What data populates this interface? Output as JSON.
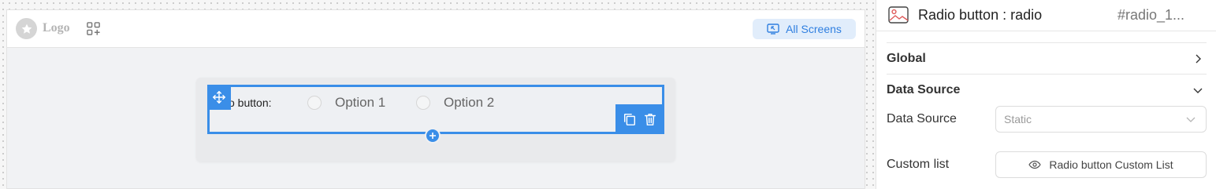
{
  "canvas": {
    "logo_text": "Logo",
    "all_screens_label": "All Screens",
    "widget": {
      "label": "o button:",
      "options": [
        {
          "label": "Option 1",
          "selected": false
        },
        {
          "label": "Option 2",
          "selected": false
        }
      ]
    }
  },
  "panel": {
    "title": "Radio button : radio",
    "component_id": "#radio_1...",
    "sections": {
      "global": "Global",
      "data_source": "Data Source"
    },
    "fields": {
      "data_source_label": "Data Source",
      "data_source_value": "Static",
      "custom_list_label": "Custom list",
      "custom_list_button": "Radio button Custom List"
    }
  },
  "colors": {
    "accent": "#3a8ee8",
    "all_screens_bg": "#e1edfb",
    "all_screens_text": "#2f7fe0"
  },
  "icons": [
    "star-icon",
    "add-widget-icon",
    "screens-icon",
    "move-icon",
    "duplicate-icon",
    "trash-icon",
    "plus-icon",
    "image-icon",
    "chevron-right-icon",
    "chevron-down-icon",
    "eye-icon"
  ]
}
